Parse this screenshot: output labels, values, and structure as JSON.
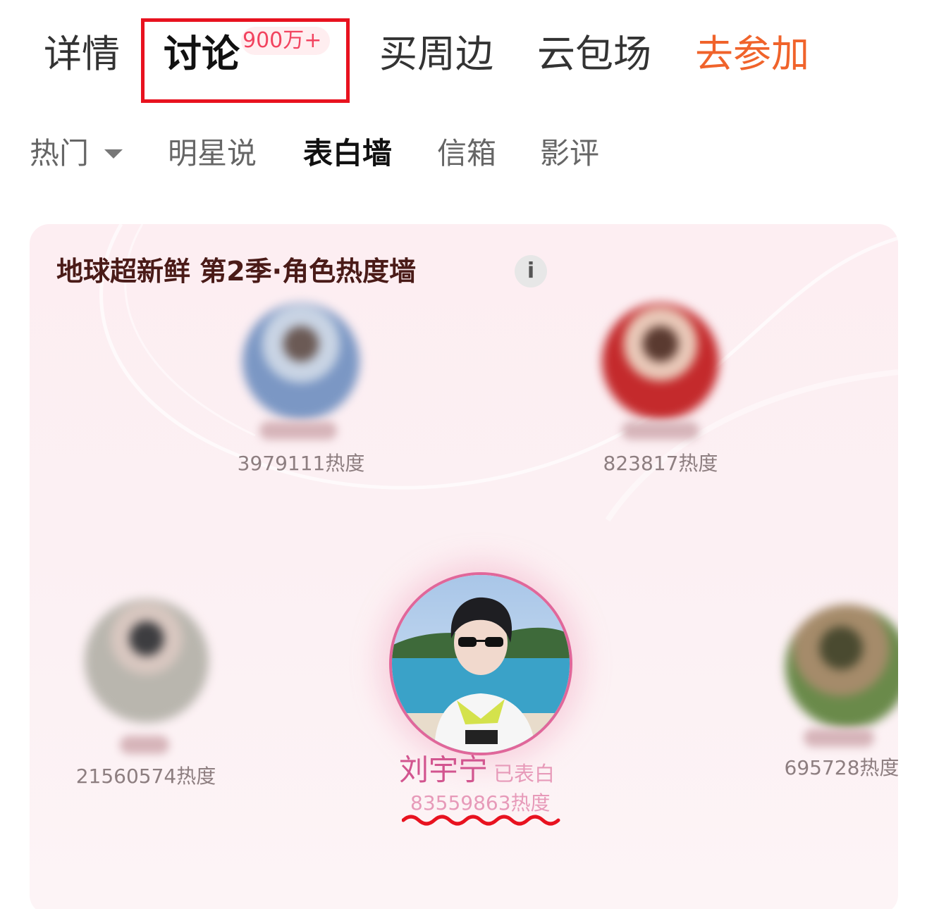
{
  "top_tabs": {
    "details": "详情",
    "discussion": "讨论",
    "discussion_badge": "900万+",
    "merch": "买周边",
    "cloud_screening": "云包场",
    "join": "去参加"
  },
  "sub_tabs": {
    "hot": "热门",
    "star_says": "明星说",
    "confession_wall": "表白墙",
    "mailbox": "信箱",
    "reviews": "影评"
  },
  "card": {
    "title": "地球超新鲜 第2季·角色热度墙",
    "info_icon": "i"
  },
  "characters": [
    {
      "heat": "3979111热度"
    },
    {
      "heat": "823817热度"
    },
    {
      "heat": "21560574热度"
    },
    {
      "heat": "695728热度"
    }
  ],
  "featured": {
    "name": "刘宇宁",
    "status": "已表白",
    "heat": "83559863热度"
  },
  "colors": {
    "accent_orange": "#f0632b",
    "highlight_red": "#e8121f",
    "featured_pink": "#d2558f",
    "title_brown": "#4a1b18"
  }
}
